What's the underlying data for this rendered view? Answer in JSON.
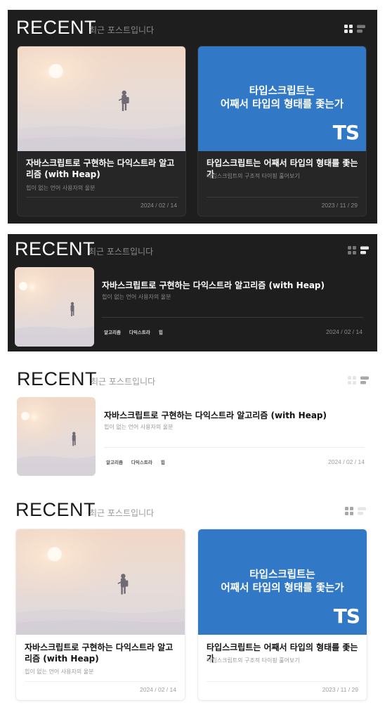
{
  "section": {
    "title": "RECENT",
    "subtitle": "최근 포스트입니다"
  },
  "posts": [
    {
      "title": "자바스크립트로 구현하는 다익스트라 알고리즘 (with Heap)",
      "description": "힙이 없는 언어 사용자의 울분",
      "date": "2024 / 02 / 14",
      "tags": [
        "알고리즘",
        "다익스트라",
        "힙"
      ]
    },
    {
      "title": "타입스크립트는 어째서 타입의 형태를 좇는가",
      "description": "타입스크립트의 구조적 타이핑 훑어보기",
      "date": "2023 / 11 / 29",
      "thumbnail_text": [
        "타입스크립트는",
        "어째서 타입의 형태를 좇는가"
      ],
      "thumbnail_logo": "TS"
    }
  ],
  "icons": {
    "grid_view": "grid-view-icon",
    "list_view": "list-view-icon"
  },
  "colors": {
    "dark_bg": "#1e1e1e",
    "ts_blue": "#3178c6"
  }
}
